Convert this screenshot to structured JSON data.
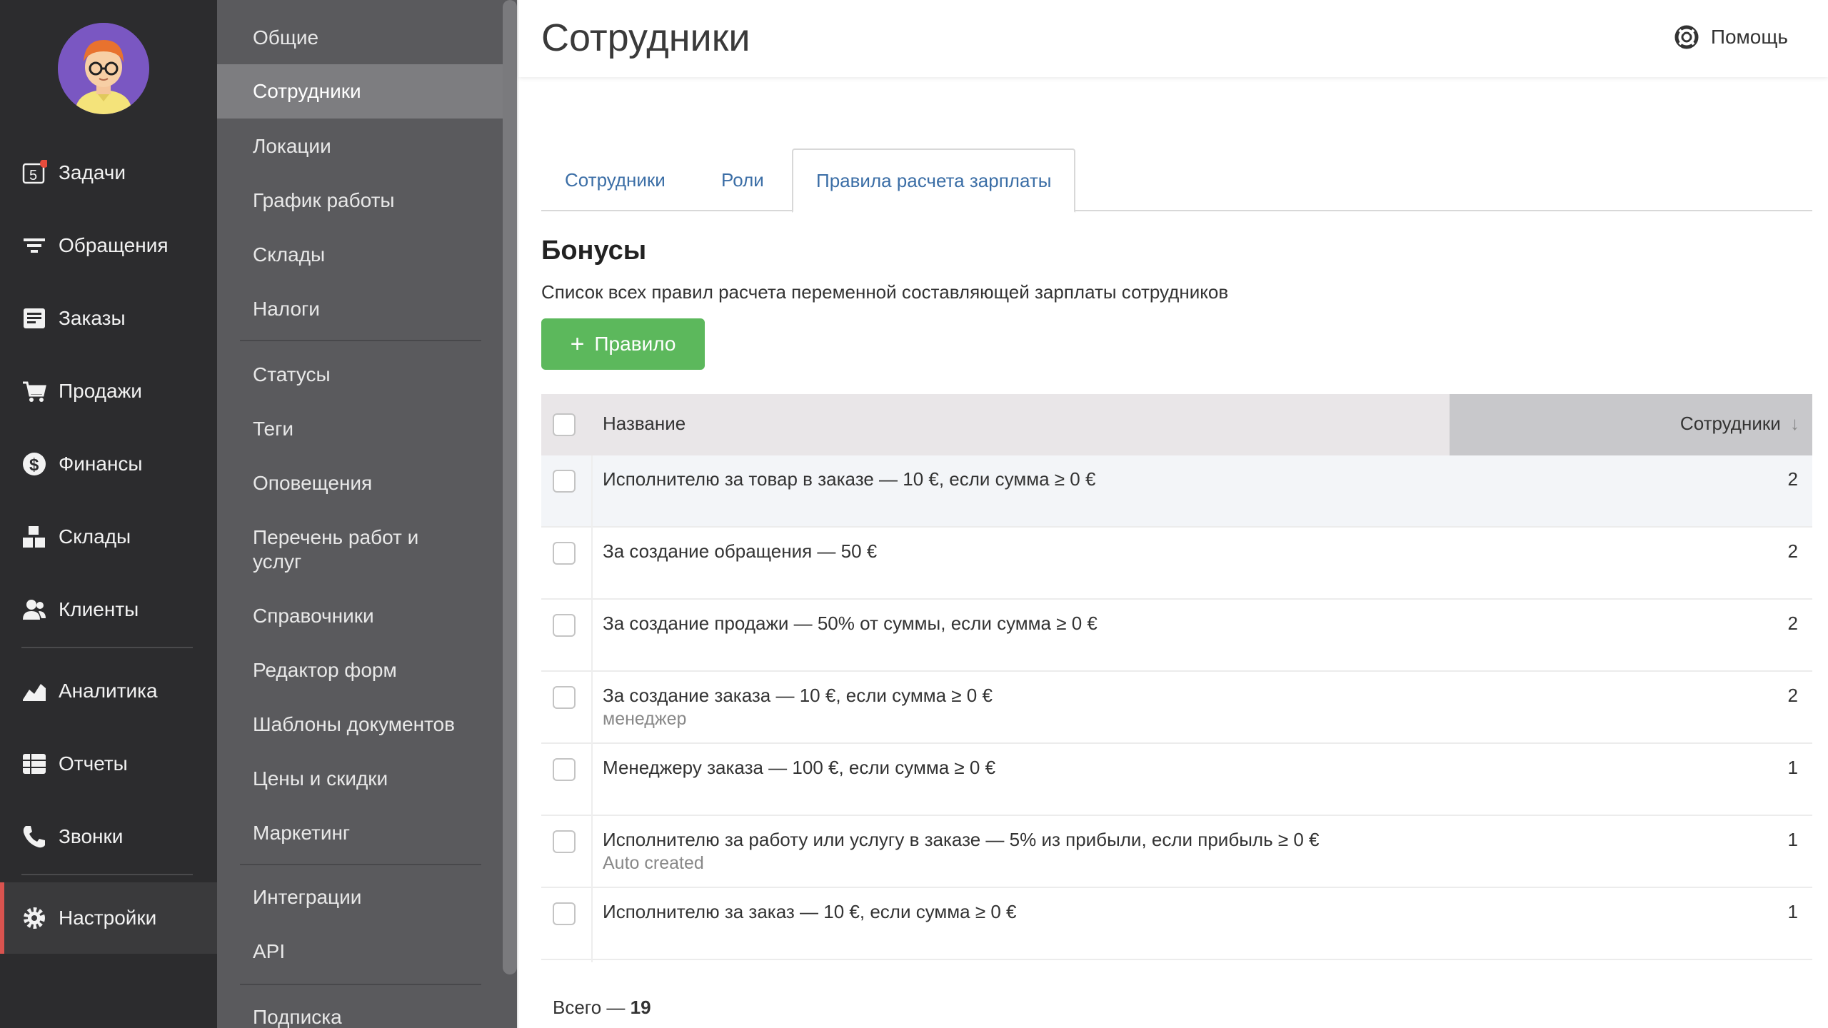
{
  "nav": {
    "badge_count": "5",
    "items": [
      {
        "label": "Задачи",
        "icon": "tasks-icon"
      },
      {
        "label": "Обращения",
        "icon": "filter-icon"
      },
      {
        "label": "Заказы",
        "icon": "orders-icon"
      },
      {
        "label": "Продажи",
        "icon": "cart-icon"
      },
      {
        "label": "Финансы",
        "icon": "dollar-icon"
      },
      {
        "label": "Склады",
        "icon": "boxes-icon"
      },
      {
        "label": "Клиенты",
        "icon": "clients-icon"
      },
      {
        "label": "Аналитика",
        "icon": "analytics-icon"
      },
      {
        "label": "Отчеты",
        "icon": "reports-icon"
      },
      {
        "label": "Звонки",
        "icon": "phone-icon"
      },
      {
        "label": "Настройки",
        "icon": "gear-icon"
      }
    ]
  },
  "submenu": {
    "items": [
      "Общие",
      "Сотрудники",
      "Локации",
      "График работы",
      "Склады",
      "Налоги",
      "Статусы",
      "Теги",
      "Оповещения",
      "Перечень работ и услуг",
      "Справочники",
      "Редактор форм",
      "Шаблоны документов",
      "Цены и скидки",
      "Маркетинг",
      "Интеграции",
      "API",
      "Подписка"
    ]
  },
  "header": {
    "title": "Сотрудники",
    "help_label": "Помощь"
  },
  "tabs": [
    "Сотрудники",
    "Роли",
    "Правила расчета зарплаты"
  ],
  "section": {
    "title": "Бонусы",
    "description": "Список всех правил расчета переменной составляющей зарплаты сотрудников",
    "add_button": "Правило",
    "add_plus": "+"
  },
  "table": {
    "col_name": "Название",
    "col_employees": "Сотрудники",
    "sort_arrow": "↓",
    "rows": [
      {
        "name": "Исполнителю за товар в заказе — 10 €, если сумма ≥ 0 €",
        "sub": "",
        "count": "2"
      },
      {
        "name": "За создание обращения — 50 €",
        "sub": "",
        "count": "2"
      },
      {
        "name": "За создание продажи — 50% от суммы, если сумма ≥ 0 €",
        "sub": "",
        "count": "2"
      },
      {
        "name": "За создание заказа — 10 €, если сумма ≥ 0 €",
        "sub": "менеджер",
        "count": "2"
      },
      {
        "name": "Менеджеру заказа — 100 €, если сумма ≥ 0 €",
        "sub": "",
        "count": "1"
      },
      {
        "name": "Исполнителю за работу или услугу в заказе — 5% из прибыли, если прибыль ≥ 0 €",
        "sub": "Auto created",
        "count": "1"
      },
      {
        "name": "Исполнителю за заказ — 10 €, если сумма ≥ 0 €",
        "sub": "",
        "count": "1"
      }
    ]
  },
  "footer": {
    "total_label": "Всего —",
    "total_value": "19"
  }
}
